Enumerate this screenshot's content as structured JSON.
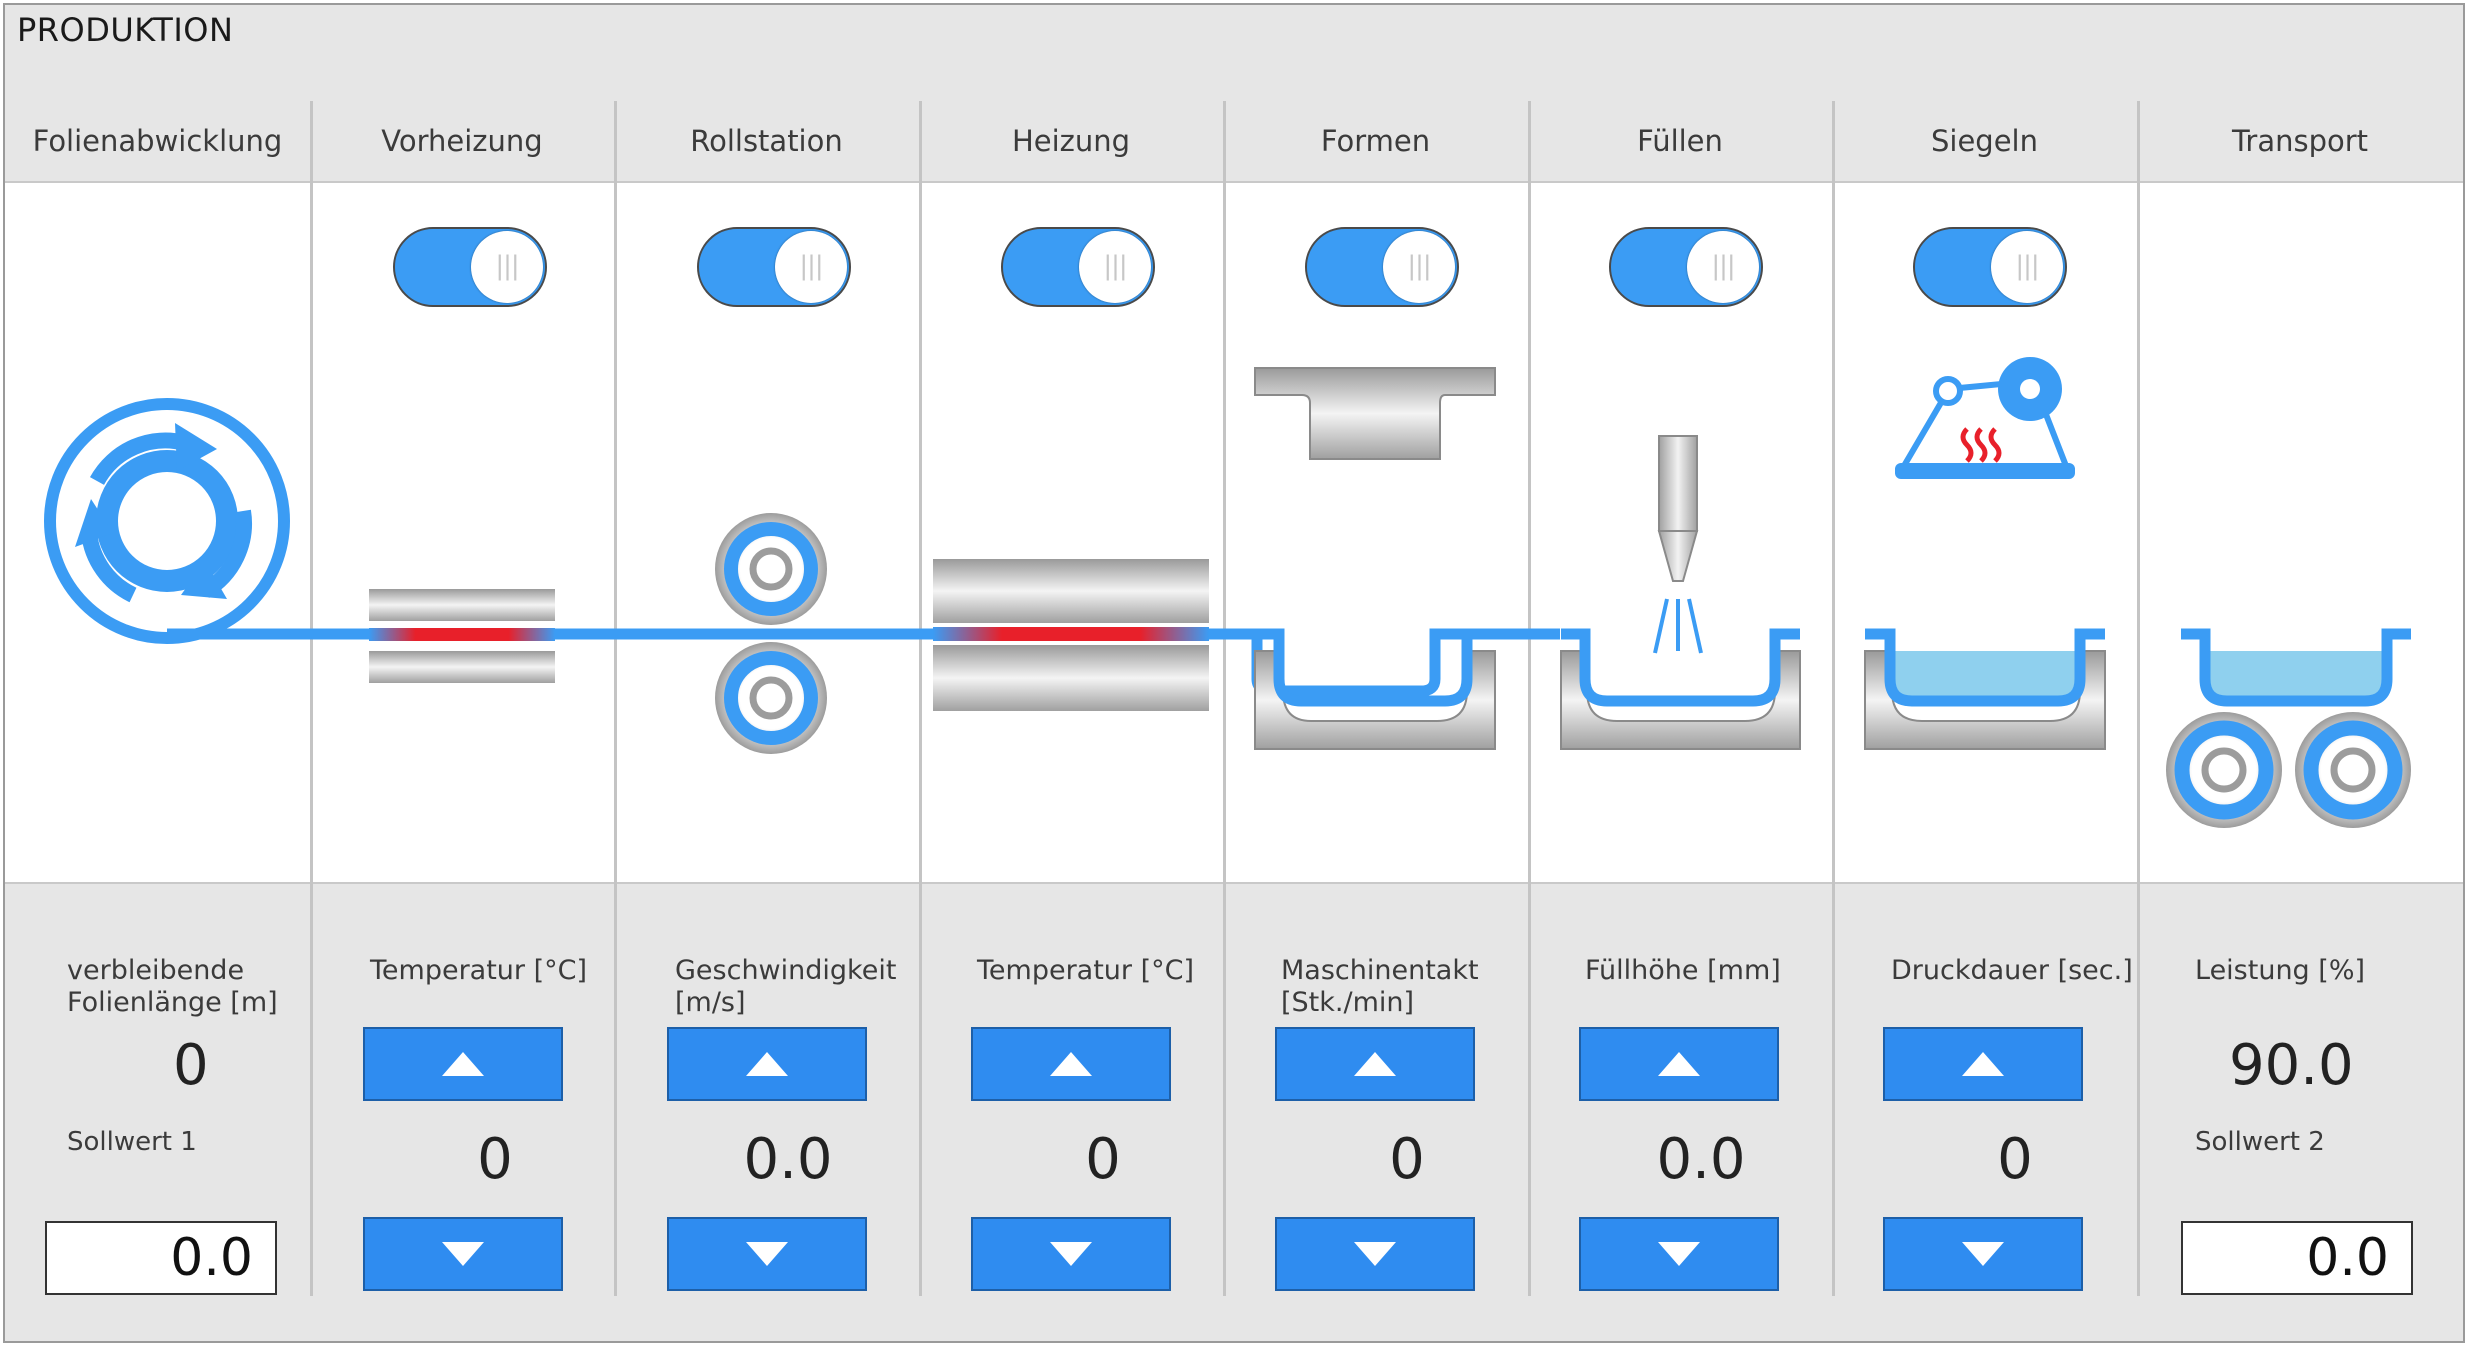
{
  "title": "PRODUKTION",
  "stations": [
    {
      "name": "Folienabwicklung"
    },
    {
      "name": "Vorheizung",
      "toggle_on": true,
      "label": "Temperatur [°C]",
      "value": "0"
    },
    {
      "name": "Rollstation",
      "toggle_on": true,
      "label": "Geschwindigkeit\n[m/s]",
      "value": "0.0"
    },
    {
      "name": "Heizung",
      "toggle_on": true,
      "label": "Temperatur [°C]",
      "value": "0"
    },
    {
      "name": "Formen",
      "toggle_on": true,
      "label": "Maschinentakt\n[Stk./min]",
      "value": "0"
    },
    {
      "name": "Füllen",
      "toggle_on": true,
      "label": "Füllhöhe [mm]",
      "value": "0.0"
    },
    {
      "name": "Siegeln",
      "toggle_on": true,
      "label": "Druckdauer [sec.]",
      "value": "0"
    },
    {
      "name": "Transport"
    }
  ],
  "unwind": {
    "label": "verbleibende\nFolienlänge [m]",
    "value": "0",
    "setpoint_label": "Sollwert 1",
    "setpoint_value": "0.0"
  },
  "transport": {
    "label": "Leistung [%]",
    "value": "90.0",
    "setpoint_label": "Sollwert 2",
    "setpoint_value": "0.0"
  },
  "colors": {
    "accent": "#3b9cf4",
    "button": "#2f8cf0",
    "heat": "#e8202a",
    "fluid": "#8fd0ee",
    "panel": "#e6e6e6"
  },
  "icons": {
    "up": "arrow-up-icon",
    "down": "arrow-down-icon",
    "roll": "film-roll-icon",
    "toggle_grip": "grip-lines-icon"
  }
}
